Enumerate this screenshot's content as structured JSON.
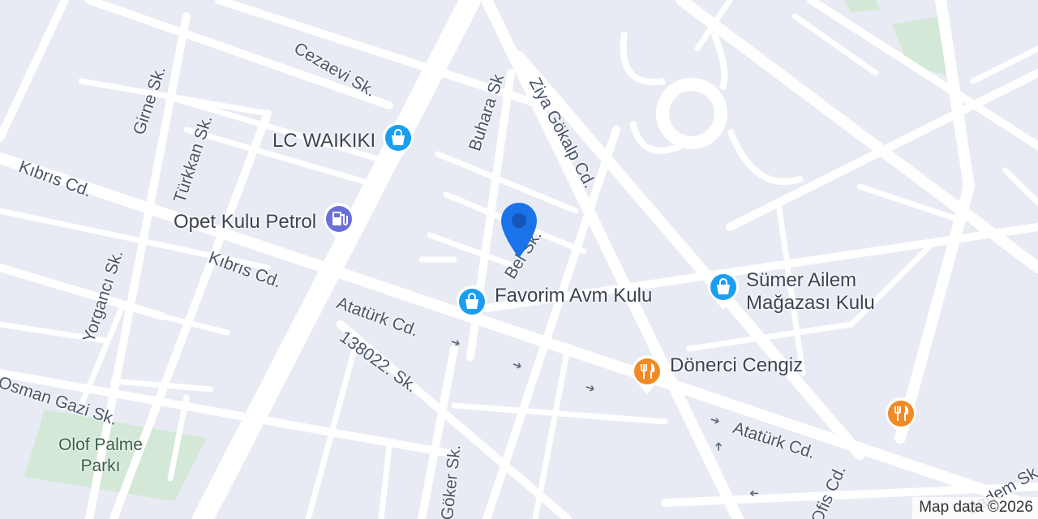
{
  "map": {
    "streets": [
      {
        "key": "cezaevi",
        "text": "Cezaevi Sk."
      },
      {
        "key": "girne",
        "text": "Girne Sk."
      },
      {
        "key": "turkkan",
        "text": "Türkkan Sk."
      },
      {
        "key": "buhara",
        "text": "Buhara Sk"
      },
      {
        "key": "ziya",
        "text": "Ziya Gökalp Cd."
      },
      {
        "key": "kibris1",
        "text": "Kıbrıs Cd."
      },
      {
        "key": "kibris2",
        "text": "Kıbrıs Cd."
      },
      {
        "key": "yorganci",
        "text": "Yorgancı Sk."
      },
      {
        "key": "belediye",
        "text": "Bel            Sk."
      },
      {
        "key": "ataturk1",
        "text": "Atatürk Cd."
      },
      {
        "key": "s138022",
        "text": "138022. Sk."
      },
      {
        "key": "osmangazi",
        "text": "Osman Gazi Sk."
      },
      {
        "key": "goker",
        "text": "Göker Sk."
      },
      {
        "key": "ataturk2",
        "text": "Atatürk Cd."
      },
      {
        "key": "ofis",
        "text": "Ofis Cd."
      },
      {
        "key": "badem",
        "text": "Badem Sk."
      }
    ],
    "pois": [
      {
        "key": "lcw",
        "name": "LC WAIKIKI",
        "icon": "shopping-bag-icon",
        "color": "#1a9ff0"
      },
      {
        "key": "opet",
        "name": "Opet Kulu Petrol",
        "icon": "fuel-pump-icon",
        "color": "#6a70d8"
      },
      {
        "key": "favorim",
        "name": "Favorim Avm Kulu",
        "icon": "shopping-bag-icon",
        "color": "#1a9ff0"
      },
      {
        "key": "sumer",
        "name": "Sümer Ailem Mağazası Kulu",
        "name_line1": "Sümer Ailem",
        "name_line2": "Mağazası Kulu",
        "icon": "shopping-bag-icon",
        "color": "#1a9ff0"
      },
      {
        "key": "doner",
        "name": "Dönerci Cengiz",
        "icon": "fork-knife-icon",
        "color": "#f08a24"
      },
      {
        "key": "rest2",
        "name": "",
        "icon": "fork-knife-icon",
        "color": "#f08a24"
      }
    ],
    "parks": [
      {
        "key": "olof",
        "line1": "Olof Palme",
        "line2": "Parkı"
      }
    ],
    "location_marker": {
      "icon": "location-pin-icon",
      "color": "#1a73e8"
    },
    "attribution": "Map data ©2026",
    "colors": {
      "background": "#e8ebf3",
      "road": "#ffffff",
      "park": "#d3e8d6"
    }
  }
}
